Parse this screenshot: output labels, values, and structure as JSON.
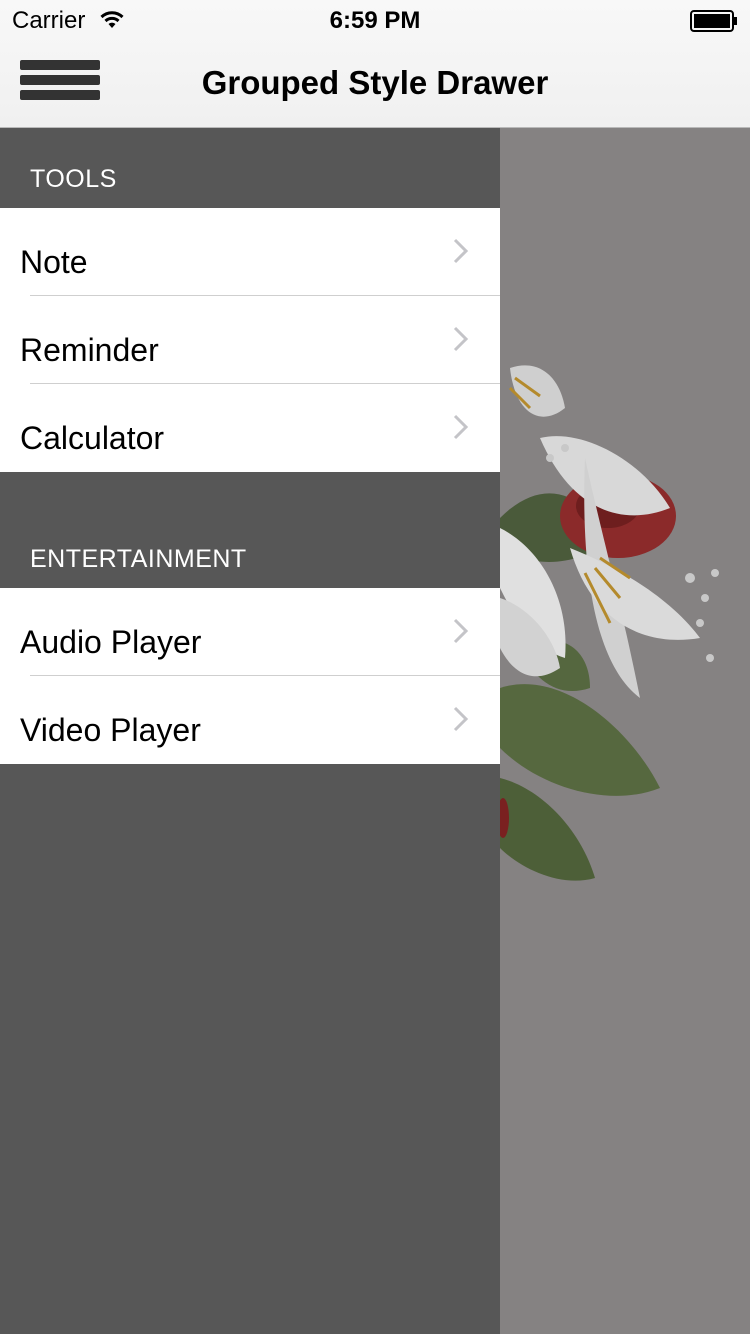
{
  "status_bar": {
    "carrier": "Carrier",
    "time": "6:59 PM"
  },
  "nav": {
    "title": "Grouped Style Drawer"
  },
  "drawer": {
    "sections": [
      {
        "header": "TOOLS",
        "items": [
          {
            "label": "Note"
          },
          {
            "label": "Reminder"
          },
          {
            "label": "Calculator"
          }
        ]
      },
      {
        "header": "ENTERTAINMENT",
        "items": [
          {
            "label": "Audio Player"
          },
          {
            "label": "Video Player"
          }
        ]
      }
    ]
  },
  "colors": {
    "drawer_background": "#575757",
    "content_overlay": "#858282",
    "cell_background": "#ffffff"
  }
}
